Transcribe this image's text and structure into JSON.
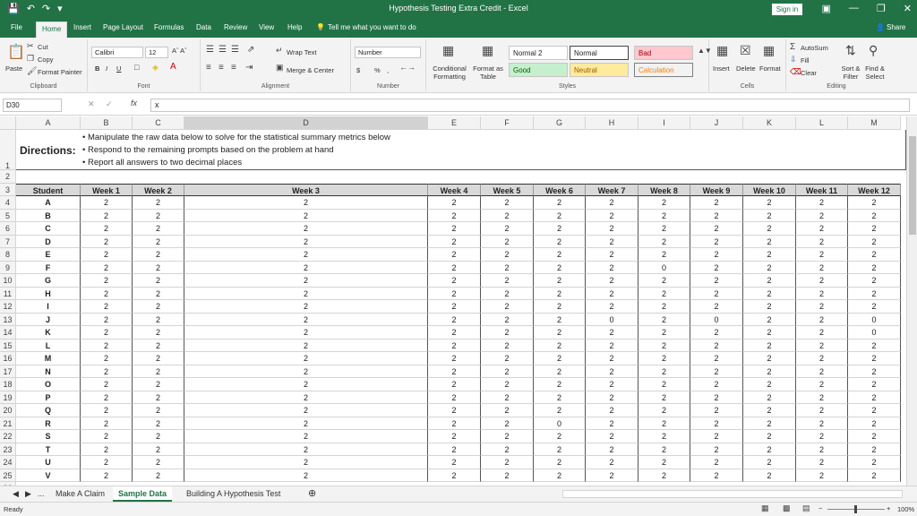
{
  "window": {
    "title": "Hypothesis Testing Extra Credit  -  Excel",
    "sign_in": "Sign in",
    "share": "Share"
  },
  "tabs": [
    "File",
    "Home",
    "Insert",
    "Page Layout",
    "Formulas",
    "Data",
    "Review",
    "View",
    "Help"
  ],
  "tell_me": "Tell me what you want to do",
  "ribbon": {
    "clipboard": {
      "paste": "Paste",
      "cut": "Cut",
      "copy": "Copy",
      "format_painter": "Format Painter",
      "label": "Clipboard"
    },
    "font": {
      "name": "Calibri",
      "size": "12",
      "bold": "B",
      "italic": "I",
      "underline": "U",
      "label": "Font"
    },
    "alignment": {
      "wrap": "Wrap Text",
      "merge": "Merge & Center",
      "label": "Alignment"
    },
    "number": {
      "format": "Number",
      "currency": "$",
      "percent": "%",
      "comma": ",",
      "label": "Number"
    },
    "styles": {
      "conditional": "Conditional Formatting",
      "format_table": "Format as Table",
      "normal2": "Normal 2",
      "normal": "Normal",
      "bad": "Bad",
      "good": "Good",
      "neutral": "Neutral",
      "calculation": "Calculation",
      "label": "Styles"
    },
    "cells": {
      "insert": "Insert",
      "delete": "Delete",
      "format": "Format",
      "label": "Cells"
    },
    "editing": {
      "autosum": "AutoSum",
      "fill": "Fill",
      "clear": "Clear",
      "sort": "Sort & Filter",
      "find": "Find & Select",
      "label": "Editing"
    }
  },
  "formula_bar": {
    "cell_ref": "D30",
    "content": "x"
  },
  "columns": [
    "A",
    "B",
    "C",
    "D",
    "E",
    "F",
    "G",
    "H",
    "I",
    "J",
    "K",
    "L",
    "M"
  ],
  "directions": {
    "label": "Directions:",
    "bullets": [
      "• Manipulate the raw data below to solve for the statistical summary metrics below",
      "• Respond to the remaining prompts based on the problem at hand",
      "• Report all answers to two decimal places"
    ]
  },
  "table": {
    "headers": [
      "Student",
      "Week 1",
      "Week 2",
      "Week 3",
      "Week 4",
      "Week 5",
      "Week 6",
      "Week 7",
      "Week 8",
      "Week 9",
      "Week 10",
      "Week 11",
      "Week 12"
    ],
    "rows": [
      [
        "A",
        "2",
        "2",
        "2",
        "2",
        "2",
        "2",
        "2",
        "2",
        "2",
        "2",
        "2",
        "2"
      ],
      [
        "B",
        "2",
        "2",
        "2",
        "2",
        "2",
        "2",
        "2",
        "2",
        "2",
        "2",
        "2",
        "2"
      ],
      [
        "C",
        "2",
        "2",
        "2",
        "2",
        "2",
        "2",
        "2",
        "2",
        "2",
        "2",
        "2",
        "2"
      ],
      [
        "D",
        "2",
        "2",
        "2",
        "2",
        "2",
        "2",
        "2",
        "2",
        "2",
        "2",
        "2",
        "2"
      ],
      [
        "E",
        "2",
        "2",
        "2",
        "2",
        "2",
        "2",
        "2",
        "2",
        "2",
        "2",
        "2",
        "2"
      ],
      [
        "F",
        "2",
        "2",
        "2",
        "2",
        "2",
        "2",
        "2",
        "0",
        "2",
        "2",
        "2",
        "2"
      ],
      [
        "G",
        "2",
        "2",
        "2",
        "2",
        "2",
        "2",
        "2",
        "2",
        "2",
        "2",
        "2",
        "2"
      ],
      [
        "H",
        "2",
        "2",
        "2",
        "2",
        "2",
        "2",
        "2",
        "2",
        "2",
        "2",
        "2",
        "2"
      ],
      [
        "I",
        "2",
        "2",
        "2",
        "2",
        "2",
        "2",
        "2",
        "2",
        "2",
        "2",
        "2",
        "2"
      ],
      [
        "J",
        "2",
        "2",
        "2",
        "2",
        "2",
        "2",
        "0",
        "2",
        "0",
        "2",
        "2",
        "0"
      ],
      [
        "K",
        "2",
        "2",
        "2",
        "2",
        "2",
        "2",
        "2",
        "2",
        "2",
        "2",
        "2",
        "0"
      ],
      [
        "L",
        "2",
        "2",
        "2",
        "2",
        "2",
        "2",
        "2",
        "2",
        "2",
        "2",
        "2",
        "2"
      ],
      [
        "M",
        "2",
        "2",
        "2",
        "2",
        "2",
        "2",
        "2",
        "2",
        "2",
        "2",
        "2",
        "2"
      ],
      [
        "N",
        "2",
        "2",
        "2",
        "2",
        "2",
        "2",
        "2",
        "2",
        "2",
        "2",
        "2",
        "2"
      ],
      [
        "O",
        "2",
        "2",
        "2",
        "2",
        "2",
        "2",
        "2",
        "2",
        "2",
        "2",
        "2",
        "2"
      ],
      [
        "P",
        "2",
        "2",
        "2",
        "2",
        "2",
        "2",
        "2",
        "2",
        "2",
        "2",
        "2",
        "2"
      ],
      [
        "Q",
        "2",
        "2",
        "2",
        "2",
        "2",
        "2",
        "2",
        "2",
        "2",
        "2",
        "2",
        "2"
      ],
      [
        "R",
        "2",
        "2",
        "2",
        "2",
        "2",
        "0",
        "2",
        "2",
        "2",
        "2",
        "2",
        "2"
      ],
      [
        "S",
        "2",
        "2",
        "2",
        "2",
        "2",
        "2",
        "2",
        "2",
        "2",
        "2",
        "2",
        "2"
      ],
      [
        "T",
        "2",
        "2",
        "2",
        "2",
        "2",
        "2",
        "2",
        "2",
        "2",
        "2",
        "2",
        "2"
      ],
      [
        "U",
        "2",
        "2",
        "2",
        "2",
        "2",
        "2",
        "2",
        "2",
        "2",
        "2",
        "2",
        "2"
      ],
      [
        "V",
        "2",
        "2",
        "2",
        "2",
        "2",
        "2",
        "2",
        "2",
        "2",
        "2",
        "2",
        "2"
      ]
    ]
  },
  "sheet_tabs": {
    "more": "...",
    "tabs": [
      "Make A Claim",
      "Sample Data",
      "Building A Hypothesis Test"
    ],
    "active": 1
  },
  "status": {
    "ready": "Ready",
    "zoom": "100%"
  },
  "colors": {
    "excel_green": "#217346",
    "bad_bg": "#ffc7ce",
    "bad_fg": "#9c0006",
    "good_bg": "#c6efce",
    "good_fg": "#006100",
    "neutral_bg": "#ffeb9c",
    "neutral_fg": "#9c5700",
    "calc_bg": "#f2f2f2",
    "calc_fg": "#fa7d00",
    "header_fill": "#d9d9d9"
  }
}
